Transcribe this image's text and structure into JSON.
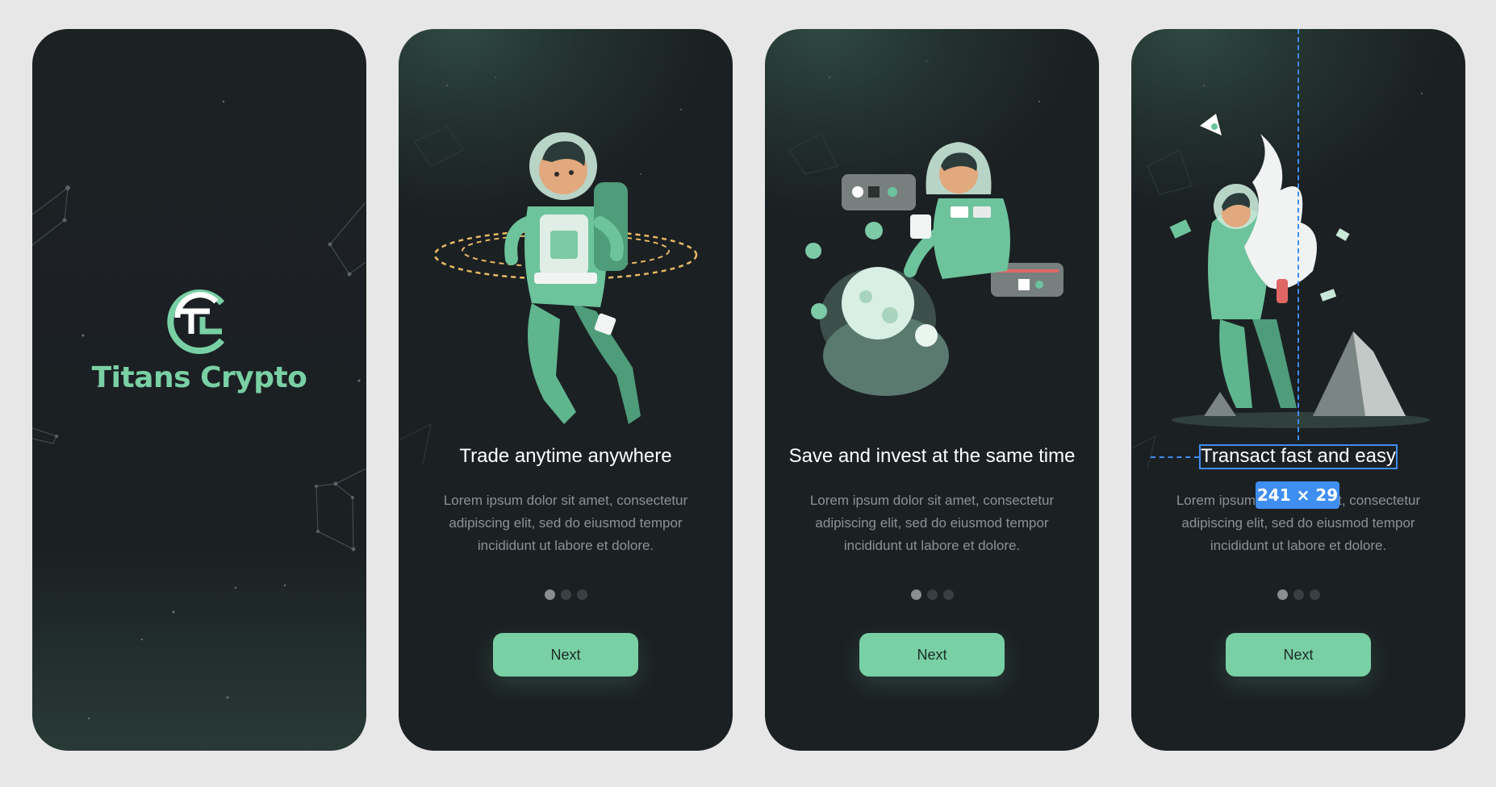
{
  "splash": {
    "brand_name": "Titans Crypto",
    "logo_letters": "TC",
    "accent_color": "#79d0a4"
  },
  "screens": [
    {
      "title": "Trade anytime anywhere",
      "description": "Lorem ipsum dolor sit amet, consectetur adipiscing elit, sed do eiusmod tempor incididunt ut labore et dolore.",
      "button_label": "Next",
      "page_indicator": {
        "total": 3,
        "active": 1
      },
      "illustration": "astronaut-floating-with-rings-icon"
    },
    {
      "title": "Save and invest at the same time",
      "description": "Lorem ipsum dolor sit amet, consectetur adipiscing elit, sed do eiusmod tempor incididunt ut labore et dolore.",
      "button_label": "Next",
      "page_indicator": {
        "total": 3,
        "active": 1
      },
      "illustration": "astronaut-with-planet-pod-icon"
    },
    {
      "title": "Transact fast and easy",
      "description": "Lorem ipsum dolor sit amet, consectetur adipiscing elit, sed do eiusmod tempor incididunt ut labore et dolore.",
      "button_label": "Next",
      "page_indicator": {
        "total": 3,
        "active": 1
      },
      "illustration": "astronaut-rocket-launch-icon"
    }
  ],
  "design_overlay": {
    "dimension_label": "241 × 29",
    "color": "#3f8ef2"
  }
}
